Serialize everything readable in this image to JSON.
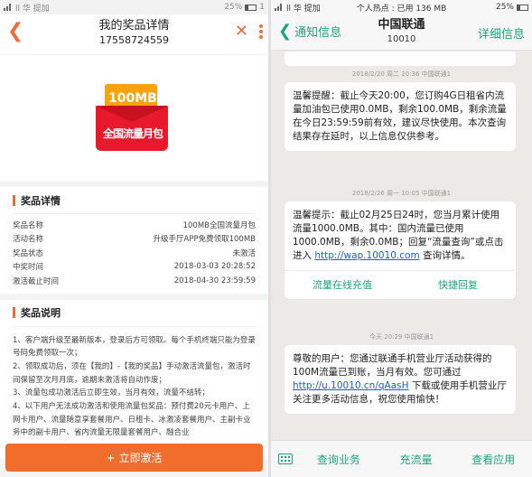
{
  "left": {
    "status": {
      "carrier": "ll 华 提加",
      "battery": "25%",
      "time": "1"
    },
    "header": {
      "title": "我的奖品详情",
      "phone": "17558724559"
    },
    "hero": {
      "badge": "100MB",
      "caption": "全国流量月包"
    },
    "detail": {
      "heading": "奖品详情",
      "rows": [
        {
          "label": "奖品名称",
          "value": "100MB全国流量月包"
        },
        {
          "label": "活动名称",
          "value": "升级手厅APP免费领取100MB"
        },
        {
          "label": "奖品状态",
          "value": "未激活"
        },
        {
          "label": "中奖时间",
          "value": "2018-03-03 20:28:52"
        },
        {
          "label": "激活截止时间",
          "value": "2018-04-30 23:59:59"
        }
      ]
    },
    "notes": {
      "heading": "奖品说明",
      "items": [
        "1、客户端升级至最新版本，登录后方可领取。每个手机终端只能为登录号码免费领取一次；",
        "2、领取成功后，须在【我的】-【我的奖品】手动激活流量包，激活时间保留至次月月底，逾期未激活将自动作废；",
        "3、流量包成功激活后立即生效，当月有效，流量不结转；",
        "4、以下用户无法成功激活和使用流量包奖品：预付费20元卡用户、上网卡用户、流量随意享套餐用户、日租卡、冰激凌套餐用户、主副卡业务中的副卡用户、省内流量无限量套餐用户、融合业"
      ]
    },
    "activate_button": "立即激活"
  },
  "right": {
    "status": {
      "left": "ll 华 提加",
      "center": "个人热点 : 已用 136 MB",
      "battery": "25%"
    },
    "header": {
      "back_label": "通知信息",
      "title": "中国联通",
      "number": "10010",
      "detail_label": "详细信息"
    },
    "messages": [
      {
        "stamp": "2018/2/20 周二 20:36 中国联通1",
        "text": "温馨提醒：截止今天20:00，您订购4G日租省内流量加油包已使用0.0MB，剩余100.0MB，剩余流量在今日23:59:59前有效，建议尽快使用。本次查询结果存在延时，以上信息仅供参考。"
      },
      {
        "stamp": "2018/2/26 周一 10:05 中国联通1",
        "text_before": "温馨提示：截止02月25日24时，您当月累计使用流量1000.0MB。其中：国内流量已使用1000.0MB，剩余0.0MB；回复“流量查询”或点击进入",
        "link": "http://wap.10010.com",
        "text_after": "查询详情。",
        "action_1": "流量在线充值",
        "action_2": "快捷回复"
      },
      {
        "stamp": "今天 20:29 中国联通1",
        "text_before": "尊敬的用户：您通过联通手机营业厅活动获得的100M流量已到账，当月有效。您可通过",
        "link": "http://u.10010.cn/qAasH",
        "text_after": "下载或使用手机营业厅关注更多活动信息，祝您使用愉快！"
      }
    ],
    "bottom_menu": [
      "查询业务",
      "充流量",
      "查看应用"
    ]
  },
  "colors": {
    "accent_orange": "#f26c2c",
    "accent_green": "#1fa37a",
    "link_blue": "#1a62c8"
  }
}
